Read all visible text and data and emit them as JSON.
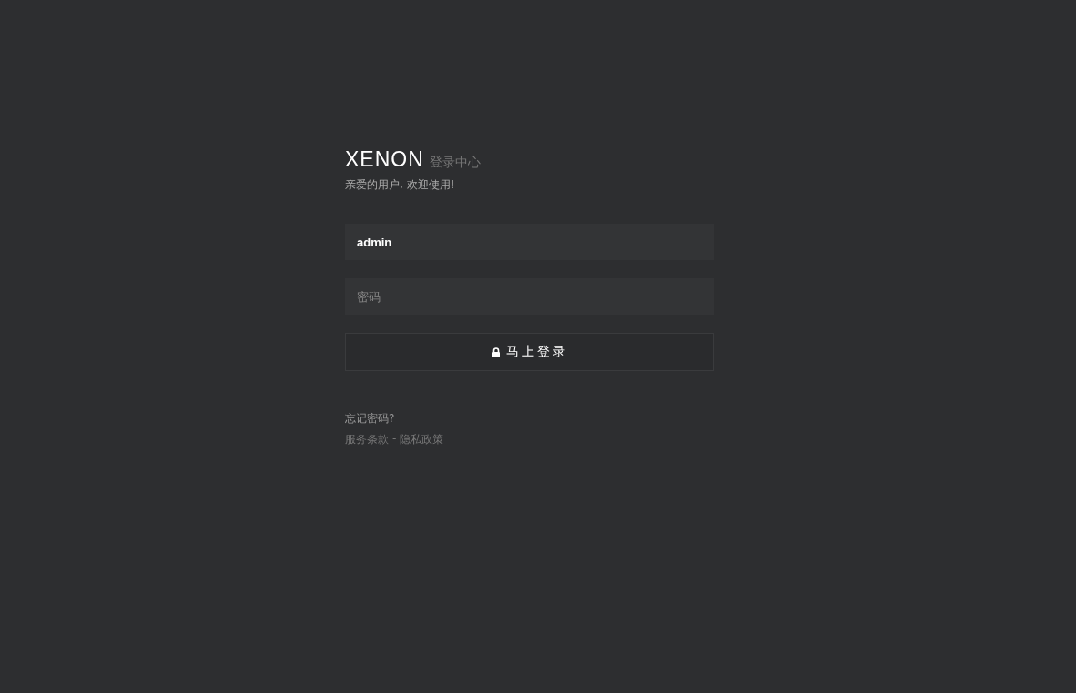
{
  "brand": {
    "logo": "XENON",
    "subtitle": "登录中心"
  },
  "greeting": "亲爱的用户, 欢迎使用!",
  "fields": [
    {
      "kind": "text",
      "value": "admin"
    },
    {
      "kind": "password",
      "placeholder": "密码"
    }
  ],
  "submit": {
    "label": "马上登录"
  },
  "forgot": "忘记密码?",
  "legal": {
    "links": [
      "服务条款",
      "隐私政策"
    ],
    "separator": "-"
  }
}
